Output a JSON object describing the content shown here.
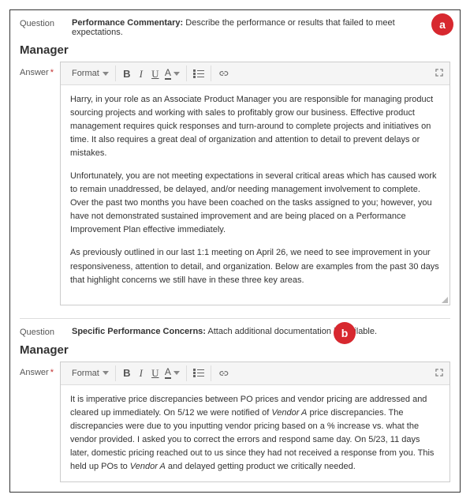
{
  "sections": [
    {
      "badge": "a",
      "question_label": "Question",
      "question_bold": "Performance Commentary:",
      "question_rest": " Describe the performance or results that failed to meet expectations.",
      "role": "Manager",
      "answer_label": "Answer",
      "required_mark": "*",
      "toolbar": {
        "format": "Format"
      },
      "paragraphs": [
        "Harry, in your role as an Associate Product Manager you are responsible for managing product sourcing projects and working with sales to profitably grow our business. Effective product management requires quick responses and turn-around to complete projects and initiatives on time. It also requires a great deal of organization and attention to detail to prevent delays or mistakes.",
        "Unfortunately, you are not meeting expectations in several critical areas which has caused work to remain unaddressed, be delayed, and/or needing management involvement to complete. Over the past two months you have been coached on the tasks assigned to you; however, you have not demonstrated sustained improvement and are being placed on a Performance Improvement Plan effective immediately.",
        "As previously outlined in our last 1:1 meeting on April 26, we need to see improvement in your responsiveness, attention to detail, and organization. Below are examples from the past 30 days that highlight concerns we still have in these three key areas."
      ]
    },
    {
      "badge": "b",
      "question_label": "Question",
      "question_bold": "Specific Performance Concerns:",
      "question_rest": " Attach additional documentation if available.",
      "role": "Manager",
      "answer_label": "Answer",
      "required_mark": "*",
      "toolbar": {
        "format": "Format"
      },
      "body_html": "It is imperative price discrepancies between PO prices and vendor pricing are addressed and cleared up immediately. On 5/12 we were notified of <em>Vendor A</em> price discrepancies. The discrepancies were due to you inputting vendor pricing based on a % increase vs. what the vendor provided. I asked you to correct the errors and respond same day. On 5/23, 11 days later, domestic pricing reached out to us since they had not received a response from you. This held up POs to <em>Vendor A</em> and delayed getting product we critically needed."
    }
  ]
}
